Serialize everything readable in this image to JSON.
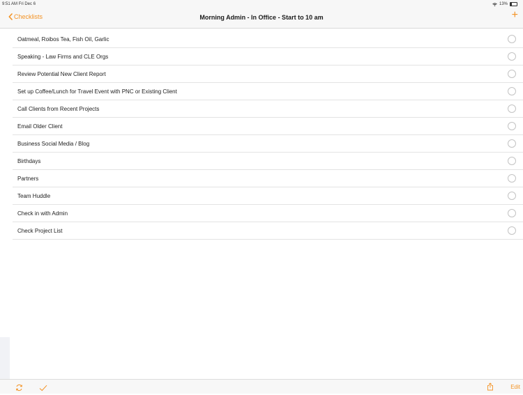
{
  "status_bar": {
    "time": "9:51 AM",
    "date": "Fri Dec 6",
    "battery": "13%"
  },
  "nav": {
    "back_label": "Checklists",
    "title": "Morning Admin - In Office - Start to 10 am",
    "add_label": "+"
  },
  "items": [
    {
      "label": "Oatmeal, Roibos Tea, Fish Oil, Garlic",
      "checked": false
    },
    {
      "label": "Speaking - Law Firms and CLE Orgs",
      "checked": false
    },
    {
      "label": "Review Potential New Client Report",
      "checked": false
    },
    {
      "label": "Set up Coffee/Lunch for Travel Event with PNC or Existing Client",
      "checked": false
    },
    {
      "label": "Call Clients from Recent Projects",
      "checked": false
    },
    {
      "label": "Email Older Client",
      "checked": false
    },
    {
      "label": "Business Social Media / Blog",
      "checked": false
    },
    {
      "label": "Birthdays",
      "checked": false
    },
    {
      "label": "Partners",
      "checked": false
    },
    {
      "label": "Team Huddle",
      "checked": false
    },
    {
      "label": "Check in with Admin",
      "checked": false
    },
    {
      "label": "Check Project List",
      "checked": false
    }
  ],
  "toolbar": {
    "edit_label": "Edit",
    "icons": [
      "refresh-icon",
      "checkmark-icon",
      "share-icon"
    ]
  },
  "colors": {
    "accent": "#f39325",
    "separator": "#e3e3e3",
    "circle": "#c3c3c3"
  }
}
